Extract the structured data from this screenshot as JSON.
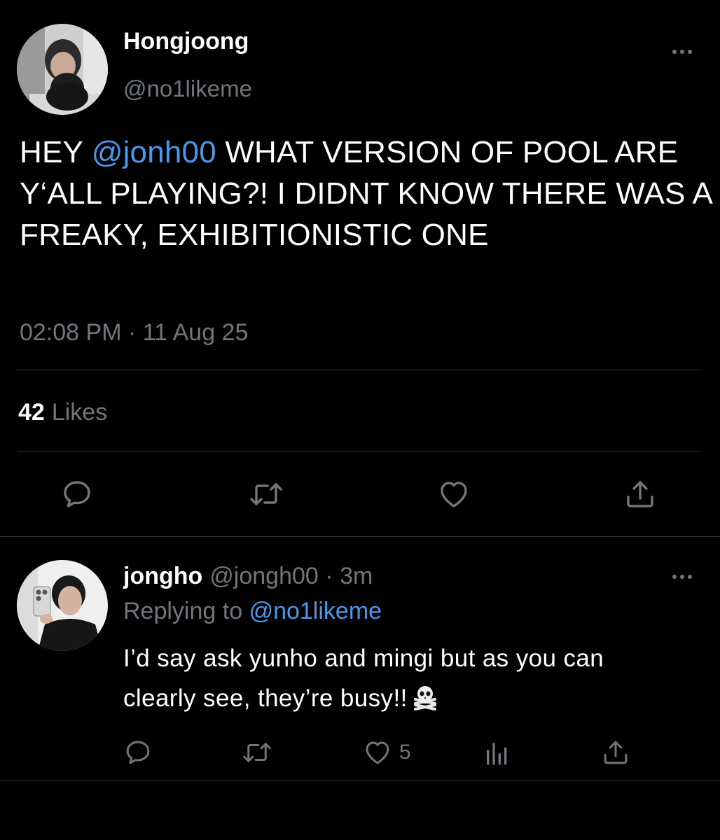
{
  "main_tweet": {
    "display_name": "Hongjoong",
    "handle": "@no1likeme",
    "text_pre": "HEY ",
    "mention": "@jonh00",
    "text_post": " WHAT VERSION OF POOL ARE Y‘ALL PLAYING?!  I DIDNT KNOW THERE WAS A FREAKY, EXHIBITIONISTIC ONE",
    "timestamp": "02:08 PM · 11 Aug 25",
    "likes_count": "42",
    "likes_label": "Likes",
    "icons": {
      "more": "more-horizontal-icon",
      "reply": "reply-bubble-icon",
      "retweet": "retweet-icon",
      "like": "heart-icon",
      "share": "share-icon"
    }
  },
  "reply": {
    "display_name": "jongho",
    "handle": "@jongh00",
    "separator": "·",
    "time": "3m",
    "replying_label": "Replying to",
    "replying_handle": "@no1likeme",
    "text_line1": "I’d say ask yunho and mingi but as you can",
    "text_line2": "clearly see, they’re busy!!",
    "emoji": "skull-and-crossbones-emoji",
    "like_count": "5",
    "icons": {
      "more": "more-horizontal-icon",
      "reply": "reply-bubble-icon",
      "retweet": "retweet-icon",
      "like": "heart-icon",
      "stats": "stats-bars-icon",
      "share": "share-icon"
    }
  },
  "colors": {
    "background": "#000000",
    "text": "#ffffff",
    "secondary_text": "#71767b",
    "link": "#4a99e9",
    "divider": "#2f3336"
  }
}
